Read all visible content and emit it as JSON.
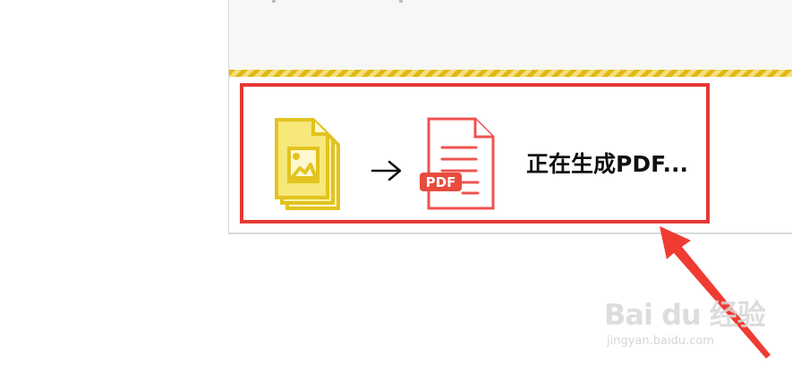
{
  "dialog": {
    "progress_indicator": {
      "icon": "striped-progress-bar",
      "colors": [
        "#e2b816",
        "#f4df7c"
      ]
    },
    "conversion": {
      "source_icon": "image-files-icon",
      "arrow_icon": "right-arrow-icon",
      "target_icon": "pdf-file-icon",
      "pdf_label": "PDF",
      "status_text": "正在生成PDF..."
    }
  },
  "annotation": {
    "highlight_color": "#e53935",
    "pointer_icon": "red-arrow-icon"
  },
  "watermark": {
    "brand": "Bai du 经验",
    "url": "jingyan.baidu.com"
  }
}
